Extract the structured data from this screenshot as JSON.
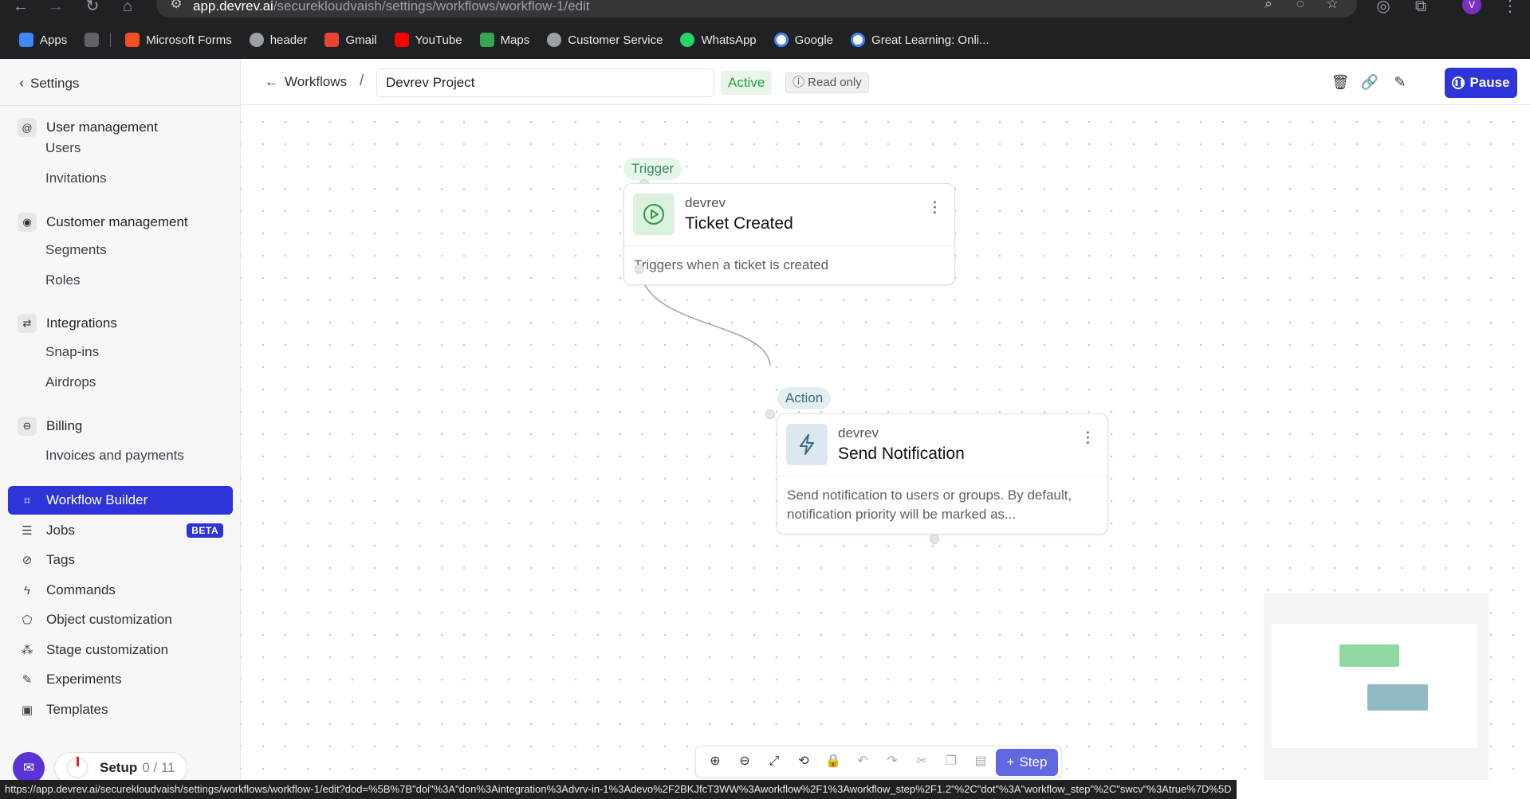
{
  "browser": {
    "url_host": "app.devrev.ai",
    "url_path": "/securekloudvaish/settings/workflows/workflow-1/edit",
    "bookmarks": [
      {
        "label": "Apps",
        "color": "#4285f4"
      },
      {
        "label": "Microsoft Forms",
        "color": "#f25022"
      },
      {
        "label": "header",
        "color": "#9aa0a6"
      },
      {
        "label": "Gmail",
        "color": "#ea4335"
      },
      {
        "label": "YouTube",
        "color": "#ff0000"
      },
      {
        "label": "Maps",
        "color": "#34a853"
      },
      {
        "label": "Customer Service",
        "color": "#9aa0a6"
      },
      {
        "label": "WhatsApp",
        "color": "#25d366"
      },
      {
        "label": "Google",
        "color": "#4285f4"
      },
      {
        "label": "Great Learning: Onli...",
        "color": "#4285f4"
      }
    ],
    "profile_initial": "V",
    "status_url": "https://app.devrev.ai/securekloudvaish/settings/workflows/workflow-1/edit?dod=%5B%7B\"doi\"%3A\"don%3Aintegration%3Advrv-in-1%3Adevo%2F2BKJfcT3WW%3Aworkflow%2F1%3Aworkflow_step%2F1.2\"%2C\"dot\"%3A\"workflow_step\"%2C\"swcv\"%3Atrue%7D%5D"
  },
  "sidebar": {
    "back_label": "Settings",
    "groups": [
      {
        "label": "User management",
        "icon": "at-icon",
        "items": [
          "Users",
          "Invitations"
        ]
      },
      {
        "label": "Customer management",
        "icon": "customer-icon",
        "items": [
          "Segments",
          "Roles"
        ]
      },
      {
        "label": "Integrations",
        "icon": "integrations-icon",
        "items": [
          "Snap-ins",
          "Airdrops"
        ]
      },
      {
        "label": "Billing",
        "icon": "billing-icon",
        "items": [
          "Invoices and payments"
        ]
      }
    ],
    "nav": [
      {
        "label": "Workflow Builder",
        "icon": "workflow-icon",
        "active": true
      },
      {
        "label": "Jobs",
        "icon": "jobs-icon",
        "badge": "BETA"
      },
      {
        "label": "Tags",
        "icon": "tag-icon"
      },
      {
        "label": "Commands",
        "icon": "bolt-icon"
      },
      {
        "label": "Object customization",
        "icon": "pentagon-icon"
      },
      {
        "label": "Stage customization",
        "icon": "stage-icon"
      },
      {
        "label": "Experiments",
        "icon": "experiment-icon"
      },
      {
        "label": "Templates",
        "icon": "template-icon"
      }
    ],
    "setup": {
      "label": "Setup",
      "progress": "0 / 11"
    }
  },
  "header": {
    "breadcrumb": "Workflows",
    "workflow_name": "Devrev Project",
    "status": "Active",
    "readonly": "Read only",
    "pause_label": "Pause",
    "accent": "#2d35d8"
  },
  "canvas": {
    "trigger": {
      "tag": "Trigger",
      "vendor": "devrev",
      "title": "Ticket Created",
      "description": "Triggers when a ticket is created"
    },
    "action": {
      "tag": "Action",
      "vendor": "devrev",
      "title": "Send Notification",
      "description": "Send notification to users or groups. By default, notification priority will be marked as..."
    },
    "step_label": "Step"
  }
}
